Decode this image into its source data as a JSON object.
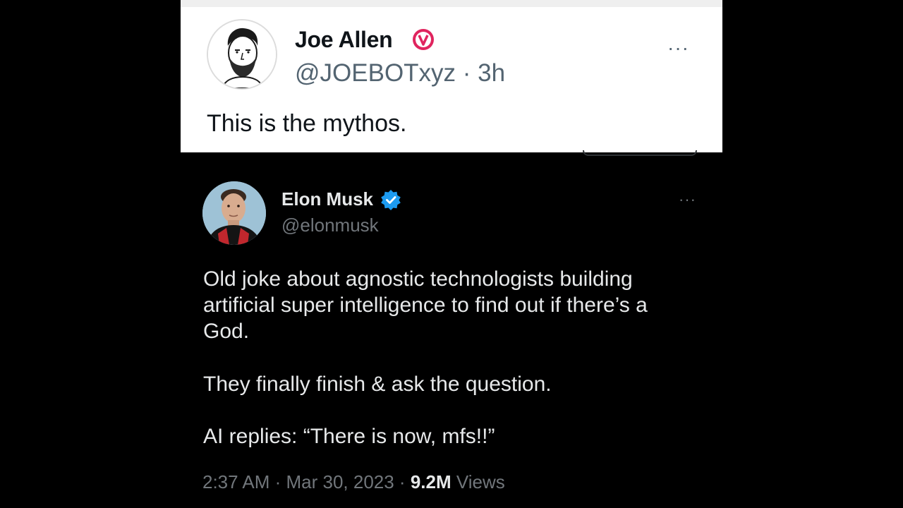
{
  "quoted_tweet": {
    "author_name": "Joe Allen",
    "handle_time": "@JOEBOTxyz · 3h",
    "more_label": "···",
    "text": "This is the mythos.",
    "badge_icon": "red-verified-icon",
    "badge_color": "#e0245e"
  },
  "tweet": {
    "author_name": "Elon Musk",
    "handle": "@elonmusk",
    "more_label": "···",
    "badge_icon": "blue-verified-icon",
    "badge_color": "#1d9bf0",
    "paragraphs": [
      [
        "Old joke about agnostic technologists building",
        "artificial super intelligence to find out if there’s a",
        "God."
      ],
      [
        "They finally finish & ask the question."
      ],
      [
        "AI replies: “There is now, mfs!!”"
      ]
    ],
    "meta": {
      "timestamp": "2:37 AM · Mar 30, 2023 · ",
      "views_count": "9.2M",
      "views_label": " Views"
    }
  },
  "colors": {
    "background": "#000000",
    "card_background": "#ffffff",
    "primary_text_dark": "#e7e9ea",
    "secondary_text_dark": "#71767b",
    "primary_text_light": "#0f1419",
    "secondary_text_light": "#536471"
  }
}
